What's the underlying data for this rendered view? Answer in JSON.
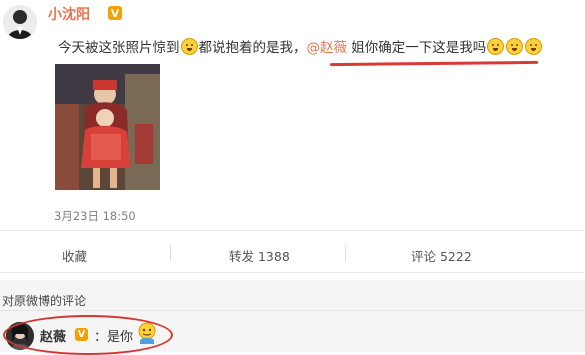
{
  "post": {
    "author": "小沈阳",
    "verified_badge": "V",
    "text_part1": "今天被这张照片惊到",
    "text_part2": "都说抱着的是我，",
    "mention": "@赵薇",
    "text_part3": " 姐你确定一下这是我吗",
    "timestamp": "3月23日 18:50"
  },
  "actions": {
    "favorite": "收藏",
    "repost": "转发 1388",
    "comment": "评论 5222"
  },
  "comments": {
    "header": "对原微博的评论",
    "item": {
      "author": "赵薇",
      "verified_badge": "V",
      "text": "：是你"
    }
  },
  "colors": {
    "accent": "#eb7350",
    "highlight_annotation": "#d6342f",
    "badge": "#f59f00"
  }
}
